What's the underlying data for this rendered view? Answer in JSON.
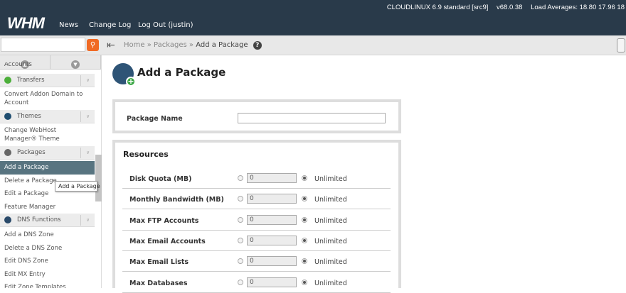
{
  "header": {
    "logo": "WHM",
    "nav": [
      "News",
      "Change Log",
      "Log Out (justin)"
    ],
    "os": "CLOUDLINUX 6.9 standard [src9]",
    "version": "v68.0.38",
    "load": "Load Averages: 18.80 17.96 18"
  },
  "breadcrumb": {
    "home": "Home",
    "sep": "»",
    "packages": "Packages",
    "current": "Add a Package"
  },
  "sidebar": {
    "partial_top": "Accounts",
    "sections": [
      {
        "label": "Transfers",
        "color": "#4caf3a",
        "items": [
          "Convert Addon Domain to Account"
        ]
      },
      {
        "label": "Themes",
        "color": "#1f4d70",
        "items": [
          "Change WebHost Manager® Theme"
        ]
      },
      {
        "label": "Packages",
        "color": "#666666",
        "items": [
          "Add a Package",
          "Delete a Package",
          "Edit a Package",
          "Feature Manager"
        ]
      },
      {
        "label": "DNS Functions",
        "color": "#2a4a6a",
        "items": [
          "Add a DNS Zone",
          "Delete a DNS Zone",
          "Edit DNS Zone",
          "Edit MX Entry",
          "Edit Zone Templates"
        ]
      }
    ],
    "selected": "Add a Package",
    "tooltip": "Add a Package"
  },
  "main": {
    "title": "Add a Package",
    "package_name_label": "Package Name",
    "package_name_value": "",
    "resources_heading": "Resources",
    "resources": [
      {
        "label": "Disk Quota (MB)",
        "value": "0",
        "option": "Unlimited"
      },
      {
        "label": "Monthly Bandwidth (MB)",
        "value": "0",
        "option": "Unlimited"
      },
      {
        "label": "Max FTP Accounts",
        "value": "0",
        "option": "Unlimited"
      },
      {
        "label": "Max Email Accounts",
        "value": "0",
        "option": "Unlimited"
      },
      {
        "label": "Max Email Lists",
        "value": "0",
        "option": "Unlimited"
      },
      {
        "label": "Max Databases",
        "value": "0",
        "option": "Unlimited"
      }
    ]
  }
}
